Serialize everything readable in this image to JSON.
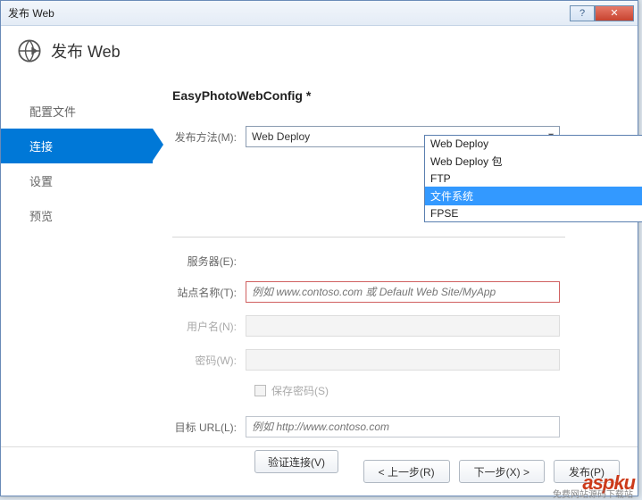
{
  "titlebar": {
    "title": "发布 Web"
  },
  "header": {
    "title": "发布 Web"
  },
  "sidebar": {
    "items": [
      {
        "label": "配置文件"
      },
      {
        "label": "连接"
      },
      {
        "label": "设置"
      },
      {
        "label": "预览"
      }
    ]
  },
  "main": {
    "config_title": "EasyPhotoWebConfig *",
    "publish_method_label": "发布方法(M):",
    "publish_method_value": "Web Deploy",
    "dropdown_options": [
      "Web Deploy",
      "Web Deploy 包",
      "FTP",
      "文件系统",
      "FPSE"
    ],
    "server_label": "服务器(E):",
    "sitename_label": "站点名称(T):",
    "sitename_placeholder": "例如 www.contoso.com 或 Default Web Site/MyApp",
    "username_label": "用户名(N):",
    "password_label": "密码(W):",
    "save_password_label": "保存密码(S)",
    "desturl_label": "目标 URL(L):",
    "desturl_placeholder": "例如 http://www.contoso.com",
    "validate_button": "验证连接(V)"
  },
  "footer": {
    "prev": "< 上一步(R)",
    "next": "下一步(X) >",
    "publish": "发布(P)"
  },
  "watermark": {
    "brand": "aspku",
    "sub": "免费网站源码下载站"
  }
}
